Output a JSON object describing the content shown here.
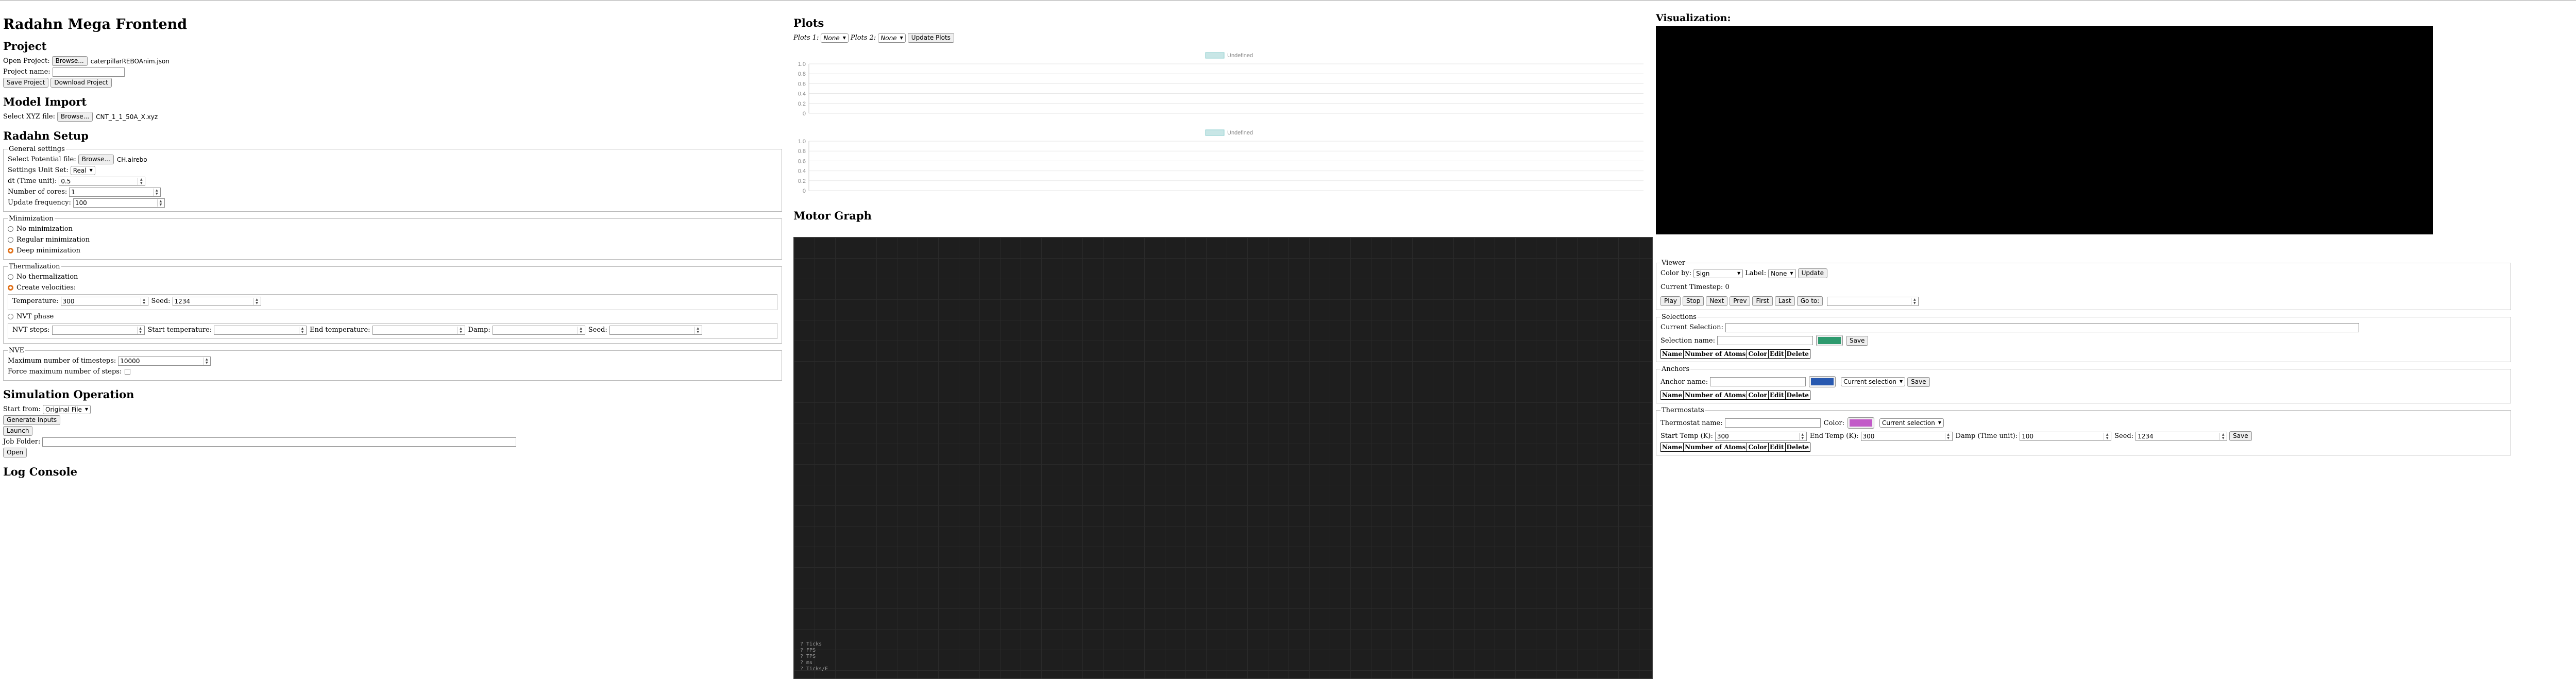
{
  "page_title": "Radahn Mega Frontend",
  "project": {
    "heading": "Project",
    "open_label": "Open Project:",
    "browse": "Browse...",
    "open_file": "caterpillarREBOAnim.json",
    "name_label": "Project name:",
    "name_value": "",
    "save_button": "Save Project",
    "download_button": "Download Project"
  },
  "model_import": {
    "heading": "Model Import",
    "xyz_label": "Select XYZ file:",
    "browse": "Browse...",
    "xyz_file": "CNT_1_1_50A_X.xyz"
  },
  "setup": {
    "heading": "Radahn Setup",
    "general": {
      "legend": "General settings",
      "potential_label": "Select Potential file:",
      "browse": "Browse...",
      "potential_file": "CH.airebo",
      "unit_label": "Settings Unit Set:",
      "unit_value": "Real",
      "dt_label": "dt (Time unit):",
      "dt_value": "0.5",
      "cores_label": "Number of cores:",
      "cores_value": "1",
      "freq_label": "Update frequency:",
      "freq_value": "100"
    },
    "minimization": {
      "legend": "Minimization",
      "options": [
        "No minimization",
        "Regular minimization",
        "Deep minimization"
      ],
      "selected_index": 2
    },
    "thermalization": {
      "legend": "Thermalization",
      "options": [
        "No thermalization",
        "Create velocities:"
      ],
      "selected_index": 1,
      "temp_label": "Temperature:",
      "temp_value": "300",
      "seed_label": "Seed:",
      "seed_value": "1234",
      "nvt_label": "NVT phase",
      "nvt_steps_label": "NVT steps:",
      "start_temp_label": "Start temperature:",
      "end_temp_label": "End temperature:",
      "damp_label": "Damp:",
      "nvt_seed_label": "Seed:"
    },
    "nve": {
      "legend": "NVE",
      "max_steps_label": "Maximum number of timesteps:",
      "max_steps_value": "10000",
      "force_label": "Force maximum number of steps:"
    }
  },
  "simulation": {
    "heading": "Simulation Operation",
    "start_from_label": "Start from:",
    "start_from_value": "Original File",
    "generate_button": "Generate Inputs",
    "launch_button": "Launch",
    "job_folder_label": "Job Folder:",
    "job_folder_value": "",
    "open_button": "Open"
  },
  "log": {
    "heading": "Log Console"
  },
  "plots": {
    "heading": "Plots",
    "plot1_label": "Plots 1:",
    "plot1_value": "None",
    "plot2_label": "Plots 2:",
    "plot2_value": "None",
    "update_button": "Update Plots"
  },
  "chart_data": [
    {
      "type": "line",
      "legend": [
        "Undefined"
      ],
      "yticks": [
        "1.0",
        "0.8",
        "0.6",
        "0.4",
        "0.2",
        "0"
      ],
      "ylim": [
        0,
        1
      ],
      "series": [],
      "grid": true,
      "legend_placement": "top-center",
      "legend_color": "#c8e6e6"
    },
    {
      "type": "line",
      "legend": [
        "Undefined"
      ],
      "yticks": [
        "1.0",
        "0.8",
        "0.6",
        "0.4",
        "0.2",
        "0"
      ],
      "ylim": [
        0,
        1
      ],
      "series": [],
      "grid": true,
      "legend_placement": "top-center",
      "legend_color": "#c8e6e6"
    }
  ],
  "motor_graph": {
    "heading": "Motor Graph",
    "stats": [
      "? Ticks",
      "? FPS",
      "? TPS",
      "? ms",
      "? Ticks/E"
    ]
  },
  "visualization": {
    "heading": "Visualization:",
    "viewer": {
      "legend": "Viewer",
      "color_by_label": "Color by:",
      "color_by_value": "Sign",
      "label_label": "Label:",
      "label_value": "None",
      "update_button": "Update",
      "timestep_label": "Current Timestep: 0",
      "controls": [
        "Play",
        "Stop",
        "Next",
        "Prev",
        "First",
        "Last",
        "Go to:"
      ]
    },
    "selections": {
      "legend": "Selections",
      "current_label": "Current Selection:",
      "name_label": "Selection name:",
      "color": "#2e9a6e",
      "save_button": "Save",
      "columns": [
        "Name",
        "Number of Atoms",
        "Color",
        "Edit",
        "Delete"
      ]
    },
    "anchors": {
      "legend": "Anchors",
      "name_label": "Anchor name:",
      "color": "#2859b0",
      "selection_value": "Current selection",
      "save_button": "Save",
      "columns": [
        "Name",
        "Number of Atoms",
        "Color",
        "Edit",
        "Delete"
      ]
    },
    "thermostats": {
      "legend": "Thermostats",
      "name_label": "Thermostat name:",
      "color_label": "Color:",
      "color": "#c25ac8",
      "selection_value": "Current selection",
      "start_label": "Start Temp (K):",
      "start_value": "300",
      "end_label": "End Temp (K):",
      "end_value": "300",
      "damp_label": "Damp (Time unit):",
      "damp_value": "100",
      "seed_label": "Seed:",
      "seed_value": "1234",
      "save_button": "Save",
      "columns": [
        "Name",
        "Number of Atoms",
        "Color",
        "Edit",
        "Delete"
      ]
    }
  }
}
